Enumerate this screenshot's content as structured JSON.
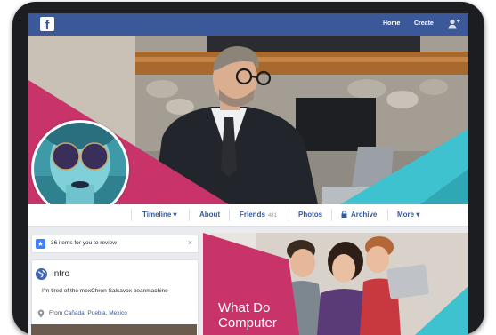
{
  "topbar": {
    "logo": "f",
    "home_label": "Home",
    "create_label": "Create"
  },
  "tabs": [
    {
      "label": "Timeline ▾"
    },
    {
      "label": "About"
    },
    {
      "label": "Friends",
      "count": "481"
    },
    {
      "label": "Photos"
    },
    {
      "label": "Archive"
    },
    {
      "label": "More ▾"
    }
  ],
  "review": {
    "text": "36 items for you to review",
    "close": "×"
  },
  "intro": {
    "title": "Intro",
    "bio": "I'm tired of the mexChron Salsavox beanmachine",
    "from_prefix": "From ",
    "from_place": "Cañada, Puebla, Mexico"
  },
  "post": {
    "title_line1": "What Do",
    "title_line2": "Computer"
  },
  "colors": {
    "facebook_blue": "#3b5998",
    "magenta": "#c8336a",
    "teal": "#3ec2cf"
  },
  "icons": {
    "logo": "facebook-f-logo",
    "friends": "friend-requests-icon",
    "star": "star-icon",
    "close": "close-icon",
    "globe": "globe-icon",
    "location": "location-pin-icon",
    "lock": "lock-icon"
  }
}
